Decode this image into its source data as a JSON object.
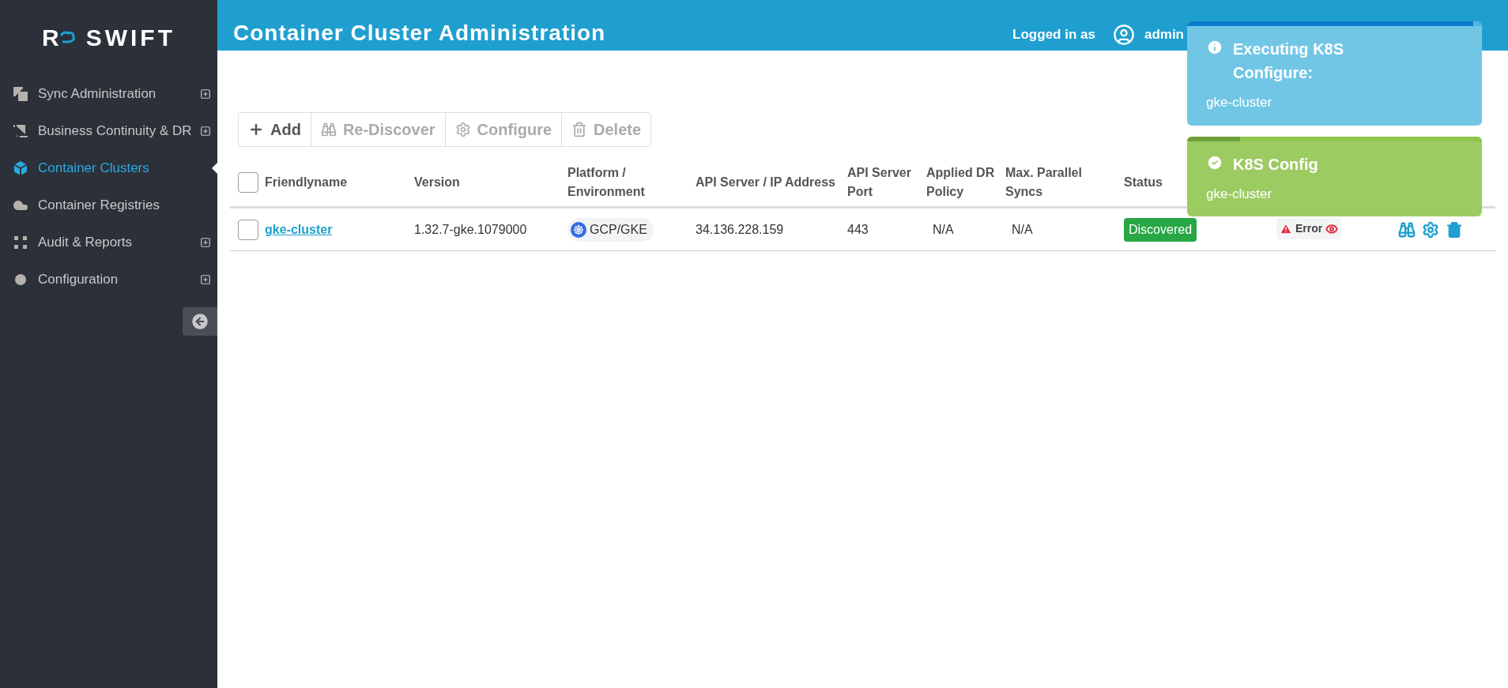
{
  "logo": {
    "letter": "R",
    "word": "SWIFT"
  },
  "sidebar": {
    "items": [
      {
        "label": "Sync Administration",
        "selected": false,
        "expandable": true
      },
      {
        "label": "Business Continuity & DR",
        "selected": false,
        "expandable": true
      },
      {
        "label": "Container Clusters",
        "selected": true,
        "expandable": false
      },
      {
        "label": "Container Registries",
        "selected": false,
        "expandable": false
      },
      {
        "label": "Audit & Reports",
        "selected": false,
        "expandable": true
      },
      {
        "label": "Configuration",
        "selected": false,
        "expandable": true
      }
    ]
  },
  "header": {
    "title": "Container Cluster Administration",
    "logged_in_label": "Logged in as",
    "user": "admin"
  },
  "toolbar": [
    {
      "label": "Add",
      "disabled": false
    },
    {
      "label": "Re-Discover",
      "disabled": true
    },
    {
      "label": "Configure",
      "disabled": true
    },
    {
      "label": "Delete",
      "disabled": true
    }
  ],
  "table": {
    "select_all_checked": false,
    "columns": [
      "Friendlyname",
      "Version",
      "Platform / Environment",
      "API Server / IP Address",
      "API Server Port",
      "Applied DR Policy",
      "Max. Parallel Syncs",
      "Status"
    ],
    "rows": [
      {
        "checked": false,
        "name": "gke-cluster",
        "version": "1.32.7-gke.1079000",
        "platform": "GCP/GKE",
        "address": "34.136.228.159",
        "port": "443",
        "dr_policy": "N/A",
        "parallel_syncs": "N/A",
        "status": "Discovered",
        "error": "Error"
      }
    ]
  },
  "toasts": [
    {
      "kind": "info",
      "title": "Executing K8S Configure:",
      "message": "gke-cluster",
      "level": 0.97
    },
    {
      "kind": "success",
      "title": "K8S Config",
      "message": "gke-cluster",
      "level": 0.18
    }
  ]
}
